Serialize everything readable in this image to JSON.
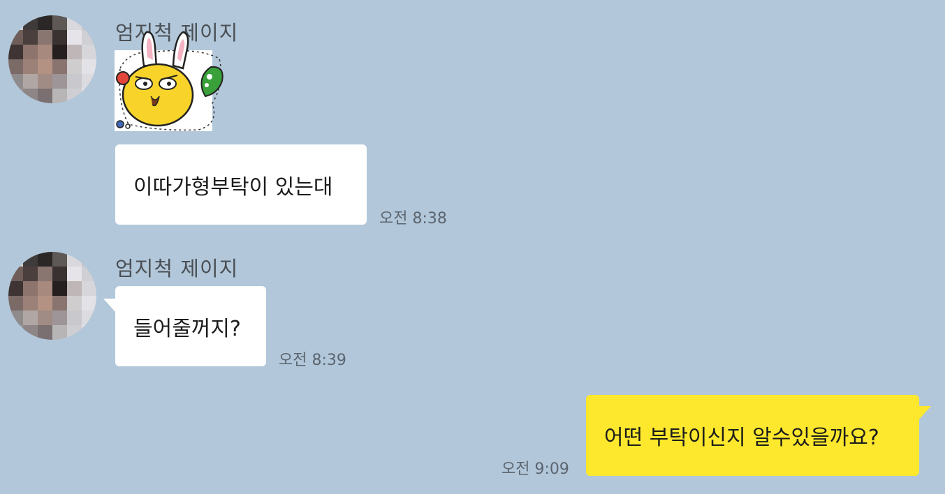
{
  "chat": {
    "messages": [
      {
        "sender": "엄지척 제이지",
        "type": "sticker",
        "sticker_name": "kakao-friend-sticker"
      },
      {
        "sender": "엄지척 제이지",
        "text": "이따가형부탁이 있는대",
        "time": "오전 8:38"
      },
      {
        "sender": "엄지척 제이지",
        "text": "들어줄꺼지?",
        "time": "오전 8:39"
      },
      {
        "sender": "me",
        "text": "어떤 부탁이신지 알수있을까요?",
        "time": "오전 9:09"
      }
    ]
  },
  "colors": {
    "background": "#b2c7d9",
    "incoming_bubble": "#ffffff",
    "outgoing_bubble": "#fde82d",
    "time_text": "#5b6570"
  }
}
